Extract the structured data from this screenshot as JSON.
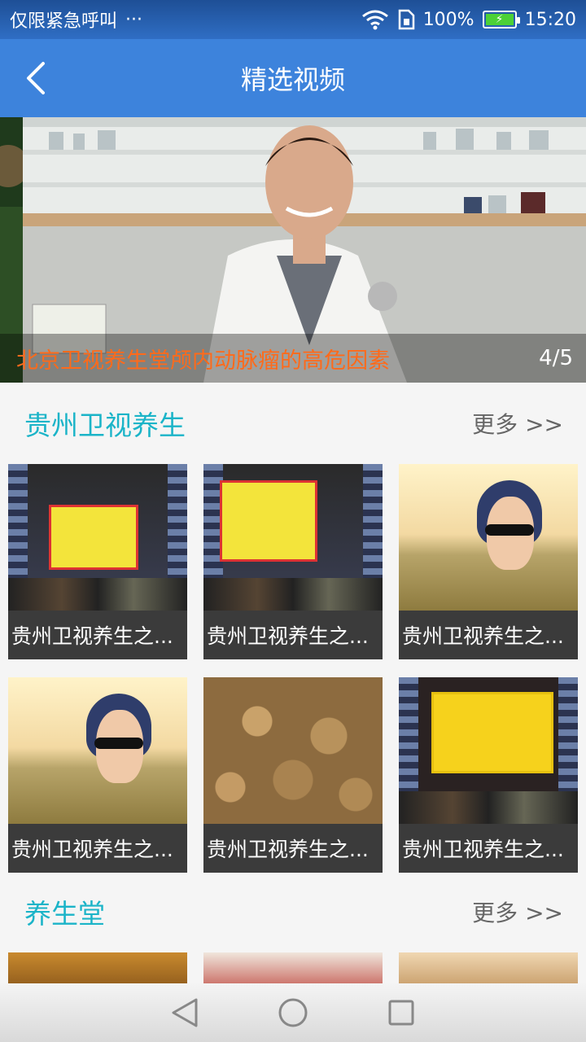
{
  "status_bar": {
    "carrier": "仅限紧急呼叫",
    "more": "···",
    "battery": "100%",
    "time": "15:20",
    "icons": [
      "wifi-icon",
      "sim-icon",
      "battery-icon"
    ]
  },
  "app_bar": {
    "title": "精选视频",
    "back_icon": "chevron-left-icon"
  },
  "banner": {
    "title": "北京卫视养生堂颅内动脉瘤的高危因素",
    "counter": "4/5",
    "caption_color": "#ff6a1a"
  },
  "sections": [
    {
      "title": "贵州卫视养生",
      "more": "更多 >>",
      "videos": [
        {
          "label": "贵州卫视养生之...",
          "thumb": "studio"
        },
        {
          "label": "贵州卫视养生之...",
          "thumb": "studio"
        },
        {
          "label": "贵州卫视养生之...",
          "thumb": "girl"
        },
        {
          "label": "贵州卫视养生之...",
          "thumb": "girl"
        },
        {
          "label": "贵州卫视养生之...",
          "thumb": "tubers"
        },
        {
          "label": "贵州卫视养生之...",
          "thumb": "tea"
        }
      ]
    },
    {
      "title": "养生堂",
      "more": "更多 >>"
    }
  ],
  "colors": {
    "app_bar": "#3d83dc",
    "section_title": "#1bb4c8",
    "card_label_bg": "#3b3b3b"
  },
  "nav": {
    "icons": [
      "back-triangle-icon",
      "home-circle-icon",
      "recent-square-icon"
    ]
  }
}
